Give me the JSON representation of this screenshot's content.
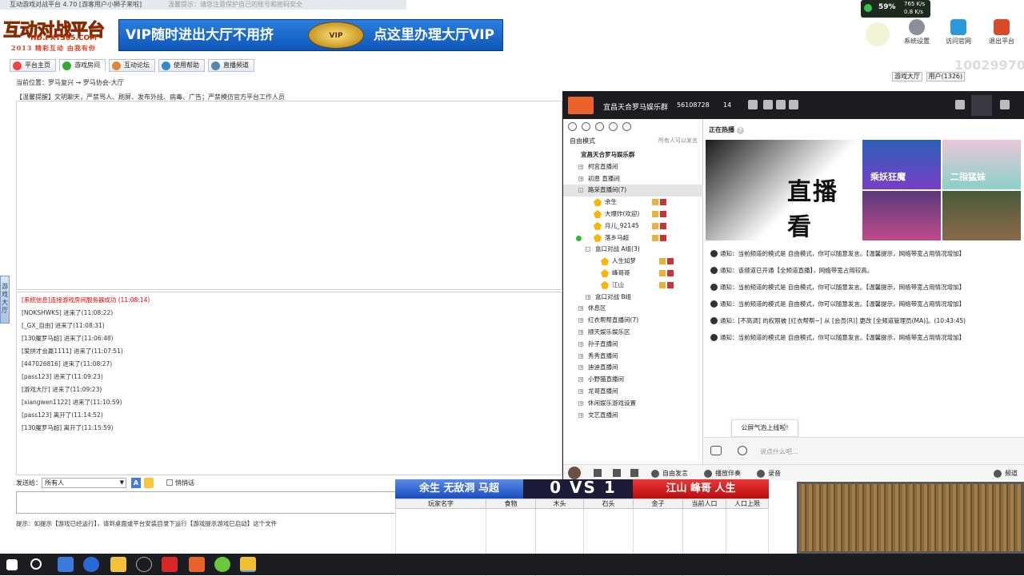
{
  "window": {
    "title": "互动游戏对战平台 4.70 [游客用户小狮子来啦]",
    "ghost_notice": "温馨提示：请您注意保护自己的账号和密码安全"
  },
  "logo": {
    "main": "互动对战平台",
    "url": "HD.FXT365.COM",
    "sub": "2013 精彩互动 由我有你"
  },
  "banner": {
    "left": "VIP随时进出大厅不用挤",
    "badge": "VIP",
    "right": "点这里办理大厅VIP"
  },
  "net": {
    "percent": "59%",
    "up": "765 K/s",
    "down": "0.8 K/s"
  },
  "right_buttons": [
    "系统设置",
    "访问官网",
    "退出平台"
  ],
  "user_id_watermark": "10029970",
  "tabs": [
    "平台主页",
    "游戏房间",
    "互动论坛",
    "使用帮助",
    "直播频道"
  ],
  "location": "当前位置：罗马复兴 → 罗马协会-大厅",
  "notice": "【温馨提醒】文明聊天，严禁骂人、刷屏、发布外挂、病毒、广告；严禁模仿官方平台工作人员",
  "side_tab": "游戏大厅",
  "right_side": {
    "tab1": "游戏大厅",
    "tab2": "用户(1326)"
  },
  "chat_log": [
    {
      "text": "[系统信息]连接游戏房间服务器成功 (11:08:14)",
      "sys": true
    },
    {
      "text": "[NOKSHWKS] 进来了(11:08:22)",
      "sys": false
    },
    {
      "text": "[_GX_自由] 进来了(11:08:31)",
      "sys": false
    },
    {
      "text": "[130魔罗马超] 进来了(11:06:48)",
      "sys": false
    },
    {
      "text": "[爱拼才会赢1111] 进来了(11:07:51)",
      "sys": false
    },
    {
      "text": "[447026816] 进来了(11:08:27)",
      "sys": false
    },
    {
      "text": "[pass123] 进来了(11:09:23)",
      "sys": false
    },
    {
      "text": "[游戏大厅] 进来了(11:09:23)",
      "sys": false
    },
    {
      "text": "[xiangwen1122] 进来了(11:10:59)",
      "sys": false
    },
    {
      "text": "[pass123] 离开了(11:14:52)",
      "sys": false
    },
    {
      "text": "[130魔罗马超] 离开了(11:15:59)",
      "sys": false
    }
  ],
  "send": {
    "label": "发送给：",
    "target": "所有人",
    "bold_btn": "A",
    "private": "悄悄话"
  },
  "hint": "提示：如提示【游戏已经运行】，请到桌面或平台安装目录下运行【游戏提示游戏已启动】这个文件",
  "player": {
    "room_name": "宜昌天合罗马娱乐群",
    "room_id": "56108728",
    "users": "14",
    "mode": "自由模式",
    "all_speak": "所有人可以发言",
    "hot_label": "正在热播",
    "hot_q": "?",
    "big_thumb": "直播看",
    "thumb_captions": [
      "乘妖狂魔",
      "二指猛妹",
      "",
      ""
    ],
    "tree": [
      {
        "label": "宜昌天合罗马娱乐群",
        "indent": 0,
        "box": "",
        "bold": true
      },
      {
        "label": "柯宫直播间",
        "indent": 1,
        "box": "+"
      },
      {
        "label": "初恩 直播间",
        "indent": 1,
        "box": "+"
      },
      {
        "label": "路采直播间(7)",
        "indent": 1,
        "box": "-",
        "sel": true
      },
      {
        "label": "余生",
        "indent": 2,
        "user": true,
        "badge": true
      },
      {
        "label": "大爆炸(欢迎)",
        "indent": 2,
        "user": true,
        "badge": true
      },
      {
        "label": "月儿_92145",
        "indent": 2,
        "user": true,
        "badge": true
      },
      {
        "label": "落乡马超",
        "indent": 2,
        "user": true,
        "badge": true,
        "green": true
      },
      {
        "label": "盒口对战 A组(3)",
        "indent": 2,
        "box": "-"
      },
      {
        "label": "人生如梦",
        "indent": 3,
        "user": true,
        "badge": true
      },
      {
        "label": "峰哥哥",
        "indent": 3,
        "user": true,
        "badge": true
      },
      {
        "label": "江山",
        "indent": 3,
        "user": true,
        "badge": true
      },
      {
        "label": "盒口对战 B组",
        "indent": 2,
        "box": "+"
      },
      {
        "label": "休息区",
        "indent": 1,
        "box": "+"
      },
      {
        "label": "红衣帮帮直播间(7)",
        "indent": 1,
        "box": "+"
      },
      {
        "label": "顺天娱乐娱乐区",
        "indent": 1,
        "box": "+"
      },
      {
        "label": "孙子直播间",
        "indent": 1,
        "box": "+"
      },
      {
        "label": "秀秀直播间",
        "indent": 1,
        "box": "+"
      },
      {
        "label": "迪迪直播间",
        "indent": 1,
        "box": "+"
      },
      {
        "label": "小野猫直播间",
        "indent": 1,
        "box": "+"
      },
      {
        "label": "龙哥直播间",
        "indent": 1,
        "box": "+"
      },
      {
        "label": "休闲娱乐游戏设置",
        "indent": 1,
        "box": "+"
      },
      {
        "label": "文艺直播间",
        "indent": 1,
        "box": "+"
      }
    ],
    "messages": [
      "通知：当前频道的模式是 自由模式，你可以随意发言。【温馨提示，网络带宽占用情况增加】",
      "通知：该频道已开通【全频道直播】，网络带宽占用较高。",
      "通知：当前频道的模式是 自由模式，你可以随意发言。【温馨提示，网络带宽占用情况增加】",
      "通知：当前频道的模式是 自由模式，你可以随意发言。【温馨提示，网络带宽占用情况增加】",
      "通知：[不高调] 的权限被 [红衣帮帮~] 从 [会员(R)] 更改 [全频道管理员(MA)]。(10:43:45)",
      "通知：当前频道的模式是 自由模式，你可以随意发言。【温馨提示，网络带宽占用情况增加】"
    ],
    "toast": "公屏气泡上线啦!",
    "input_placeholder": "说点什么吧...",
    "bottom": [
      "自由发言",
      "播放伴奏",
      "录音",
      "频道"
    ]
  },
  "vs": {
    "left_team": "余生  无敌洞  马超",
    "score": "0 VS 1",
    "right_team": "江山  峰哥  人生",
    "columns": [
      "玩家名字",
      "食物",
      "木头",
      "石头",
      "金子",
      "当前人口",
      "人口上限"
    ]
  },
  "colors": {
    "accent": "#1a4dc0",
    "red": "#d00000",
    "player_title": "#1c1d22"
  }
}
